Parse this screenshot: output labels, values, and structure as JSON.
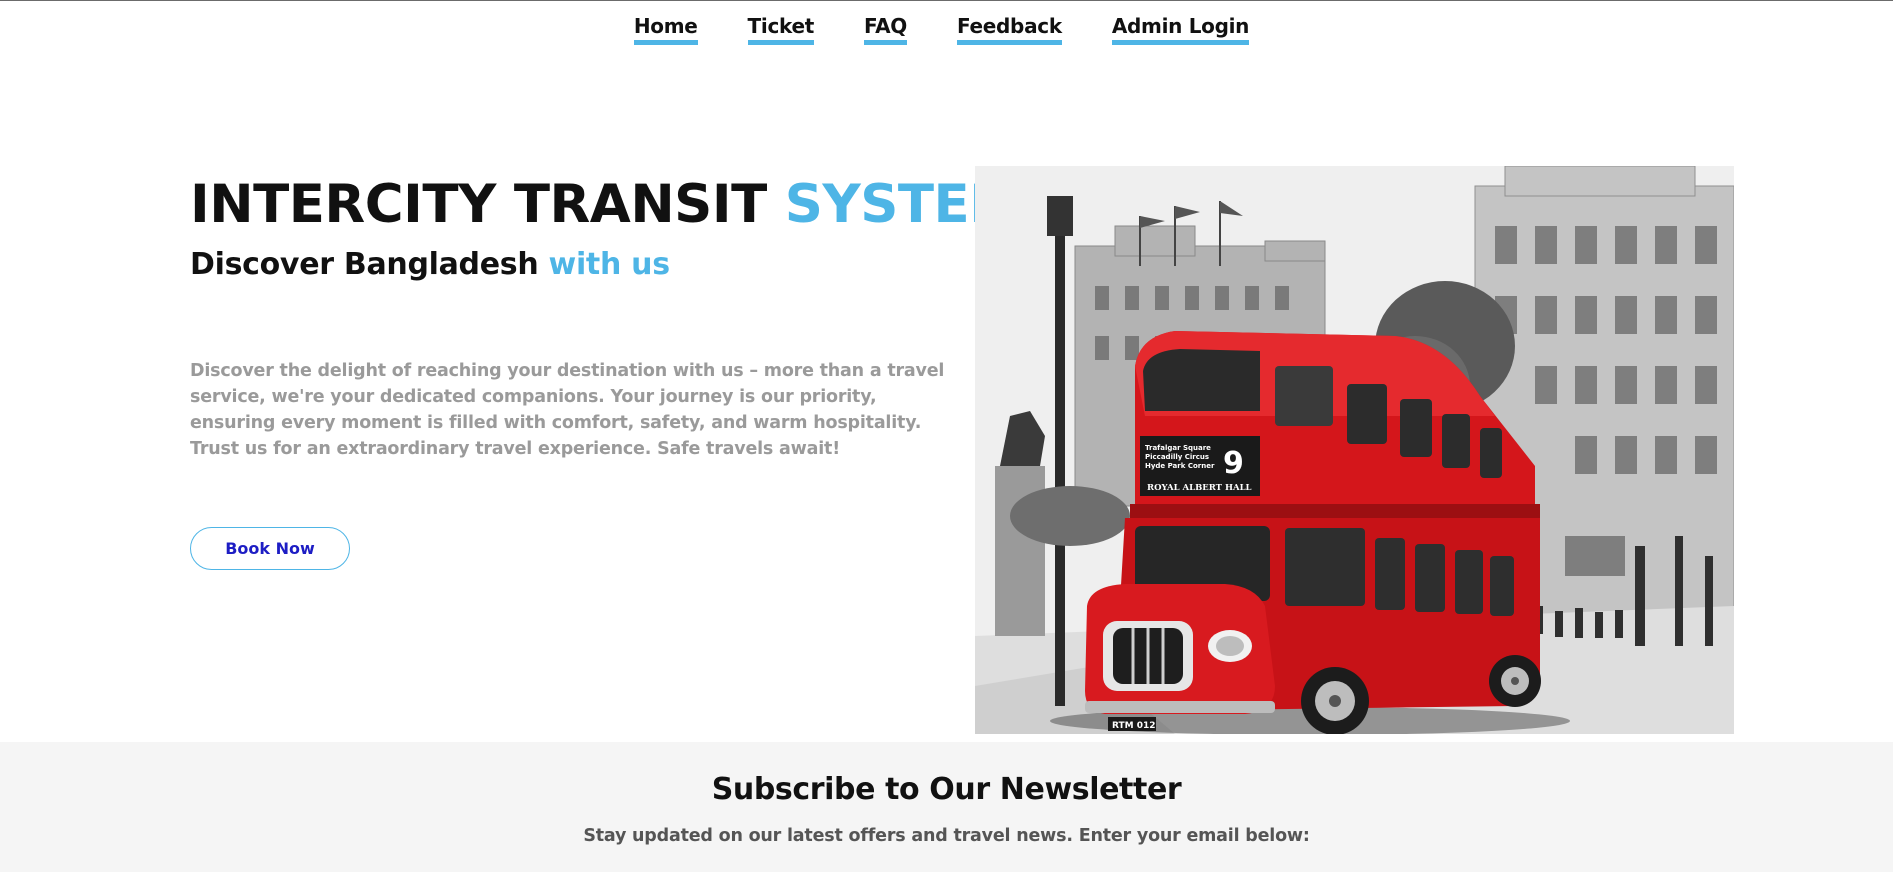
{
  "nav": {
    "items": [
      {
        "label": "Home"
      },
      {
        "label": "Ticket"
      },
      {
        "label": "FAQ"
      },
      {
        "label": "Feedback"
      },
      {
        "label": "Admin Login"
      }
    ]
  },
  "hero": {
    "title_main": "INTERCITY TRANSIT ",
    "title_accent": "SYSTEM",
    "subtitle_main": "Discover Bangladesh ",
    "subtitle_accent": "with us",
    "description": "Discover the delight of reaching your destination with us – more than a travel service, we're your dedicated companions. Your journey is our priority, ensuring every moment is filled with comfort, safety, and warm hospitality. Trust us for an extraordinary travel experience. Safe travels await!",
    "button_label": "Book Now",
    "image": {
      "bus_route_number": "9",
      "bus_destination": "ROYAL ALBERT HALL",
      "bus_route_lines": [
        "Trafalgar Square",
        "Piccadilly Circus",
        "Hyde Park Corner"
      ],
      "bus_plate": "RTM 012"
    }
  },
  "newsletter": {
    "title": "Subscribe to Our Newsletter",
    "text": "Stay updated on our latest offers and travel news. Enter your email below:"
  },
  "colors": {
    "accent": "#4eb5e6",
    "button_text": "#1d1dc4",
    "bus_red": "#d4161b",
    "newsletter_bg": "#f5f5f5"
  }
}
